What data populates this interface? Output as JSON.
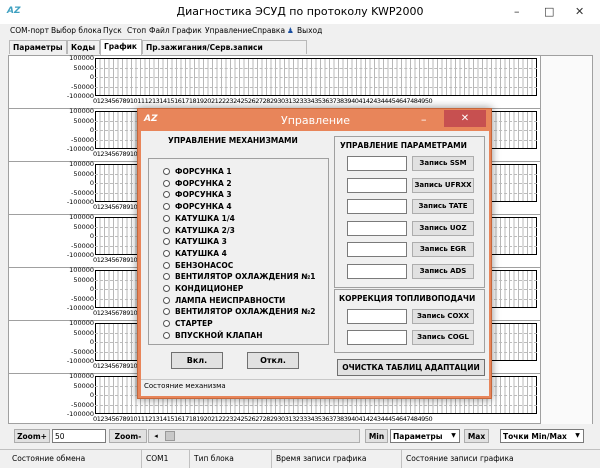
{
  "window": {
    "logo": "AZ",
    "title": "Диагностика ЭСУД по протоколу KWP2000",
    "minimize": "–",
    "maximize": "□",
    "close": "✕"
  },
  "menu": [
    "COM-порт",
    "Выбор блока",
    "Пуск",
    "Стоп",
    "Файл",
    "График",
    "Управление",
    "Справка",
    "Выход"
  ],
  "tabs": [
    "Параметры",
    "Коды",
    "График",
    "Пр.зажигания/Серв.записи"
  ],
  "chart_data": {
    "type": "line",
    "panels": 7,
    "y_labels": [
      "100000",
      "50000",
      "0",
      "-50000",
      "-100000"
    ],
    "x_categories": [
      "0",
      "1",
      "2",
      "3",
      "4",
      "5",
      "6",
      "7",
      "8",
      "9",
      "10",
      "11",
      "12",
      "13",
      "14",
      "15",
      "16",
      "17",
      "18",
      "19",
      "20",
      "21",
      "22",
      "23",
      "24",
      "25",
      "26",
      "27",
      "28",
      "29",
      "30",
      "31",
      "32",
      "33",
      "34",
      "35",
      "36",
      "37",
      "38",
      "39",
      "40",
      "41",
      "42",
      "43",
      "44",
      "45",
      "46",
      "47",
      "48",
      "49",
      "50"
    ],
    "series": []
  },
  "bottom": {
    "zoom_plus": "Zoom+",
    "zoom_value": "50",
    "zoom_minus": "Zoom-",
    "min_label": "Min",
    "param_combo": "Параметры",
    "max_label": "Max",
    "points_combo": "Точки Min/Max"
  },
  "status": {
    "exchange": "Состояние обмена",
    "port": "COM1",
    "block_type": "Тип блока",
    "record_time": "Время записи графика",
    "record_state": "Состояние записи графика"
  },
  "dialog": {
    "logo": "AZ",
    "title": "Управление",
    "mechanisms_title": "УПРАВЛЕНИЕ МЕХАНИЗМАМИ",
    "mechanisms": [
      "ФОРСУНКА 1",
      "ФОРСУНКА 2",
      "ФОРСУНКА 3",
      "ФОРСУНКА 4",
      "КАТУШКА 1/4",
      "КАТУШКА 2/3",
      "КАТУШКА 3",
      "КАТУШКА 4",
      "БЕНЗОНАСОС",
      "ВЕНТИЛЯТОР ОХЛАЖДЕНИЯ №1",
      "КОНДИЦИОНЕР",
      "ЛАМПА НЕИСПРАВНОСТИ",
      "ВЕНТИЛЯТОР ОХЛАЖДЕНИЯ №2",
      "СТАРТЕР",
      "ВПУСКНОЙ КЛАПАН"
    ],
    "on_button": "Вкл.",
    "off_button": "Откл.",
    "params_title": "УПРАВЛЕНИЕ ПАРАМЕТРАМИ",
    "param_buttons": [
      "Запись SSM",
      "Запись UFRXX",
      "Запись TATE",
      "Запись UOZ",
      "Запись EGR",
      "Запись ADS"
    ],
    "fuel_title": "КОРРЕКЦИЯ ТОПЛИВОПОДАЧИ",
    "fuel_buttons": [
      "Запись COXX",
      "Запись COGL"
    ],
    "clear_button": "ОЧИСТКА ТАБЛИЦ АДАПТАЦИИ",
    "status": "Состояние механизма"
  }
}
